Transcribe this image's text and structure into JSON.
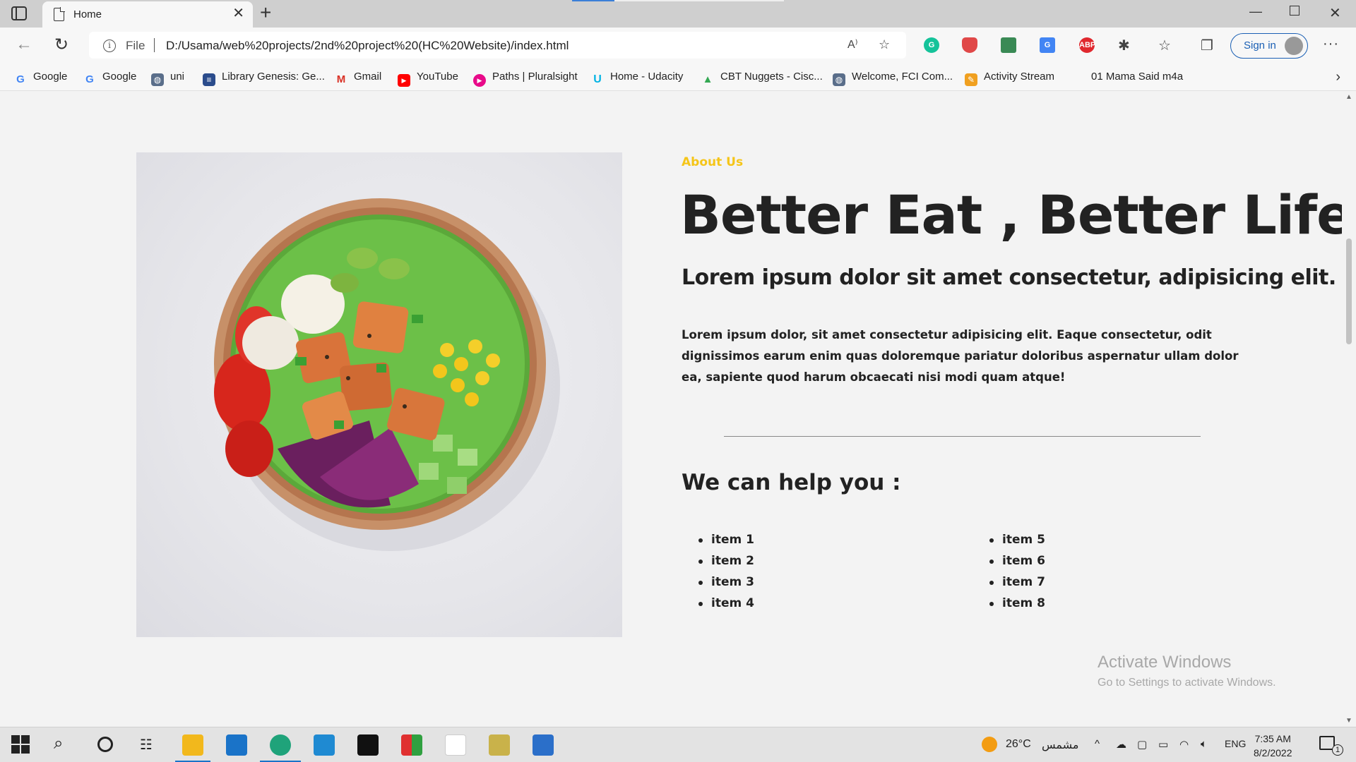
{
  "browser": {
    "tab_title": "Home",
    "address": {
      "scheme_label": "File",
      "url": "D:/Usama/web%20projects/2nd%20project%20(HC%20Website)/index.html"
    },
    "signin_label": "Sign in",
    "favorites": [
      {
        "label": "Google",
        "icon": "google-icon",
        "color": "#4285f4"
      },
      {
        "label": "Google",
        "icon": "google-icon",
        "color": "#4285f4"
      },
      {
        "label": "uni",
        "icon": "globe-icon",
        "color": "#5a6e8a"
      },
      {
        "label": "Library Genesis: Ge...",
        "icon": "book-icon",
        "color": "#2b4c8c"
      },
      {
        "label": "Gmail",
        "icon": "gmail-icon",
        "color": "#d93025"
      },
      {
        "label": "YouTube",
        "icon": "youtube-icon",
        "color": "#ff0000"
      },
      {
        "label": "Paths | Pluralsight",
        "icon": "pluralsight-icon",
        "color": "#e80a89"
      },
      {
        "label": "Home - Udacity",
        "icon": "udacity-icon",
        "color": "#02b3e4"
      },
      {
        "label": "CBT Nuggets - Cisc...",
        "icon": "drive-icon",
        "color": "#34a853"
      },
      {
        "label": "Welcome, FCI Com...",
        "icon": "globe-icon",
        "color": "#5a6e8a"
      },
      {
        "label": "Activity Stream",
        "icon": "activity-icon",
        "color": "#f0a020"
      },
      {
        "label": "01 Mama Said m4a",
        "icon": "",
        "color": ""
      }
    ]
  },
  "page": {
    "about_label": "About Us",
    "headline": "Better Eat , Better Life",
    "subhead": "Lorem ipsum dolor sit amet consectetur, adipisicing elit.",
    "paragraph": "Lorem ipsum dolor, sit amet consectetur adipisicing elit. Eaque consectetur, odit dignissimos earum enim quas doloremque pariatur doloribus aspernatur ullam dolor ea, sapiente quod harum obcaecati nisi modi quam atque!",
    "help_title": "We can help you :",
    "items_left": [
      "item 1",
      "item 2",
      "item 3",
      "item 4"
    ],
    "items_right": [
      "item 5",
      "item 6",
      "item 7",
      "item 8"
    ],
    "accent_color": "#f5c518"
  },
  "watermark": {
    "line1": "Activate Windows",
    "line2": "Go to Settings to activate Windows."
  },
  "taskbar": {
    "weather_temp": "26°C",
    "weather_text": "مشمس",
    "language": "ENG",
    "time": "7:35 AM",
    "date": "8/2/2022",
    "notification_count": "1"
  }
}
